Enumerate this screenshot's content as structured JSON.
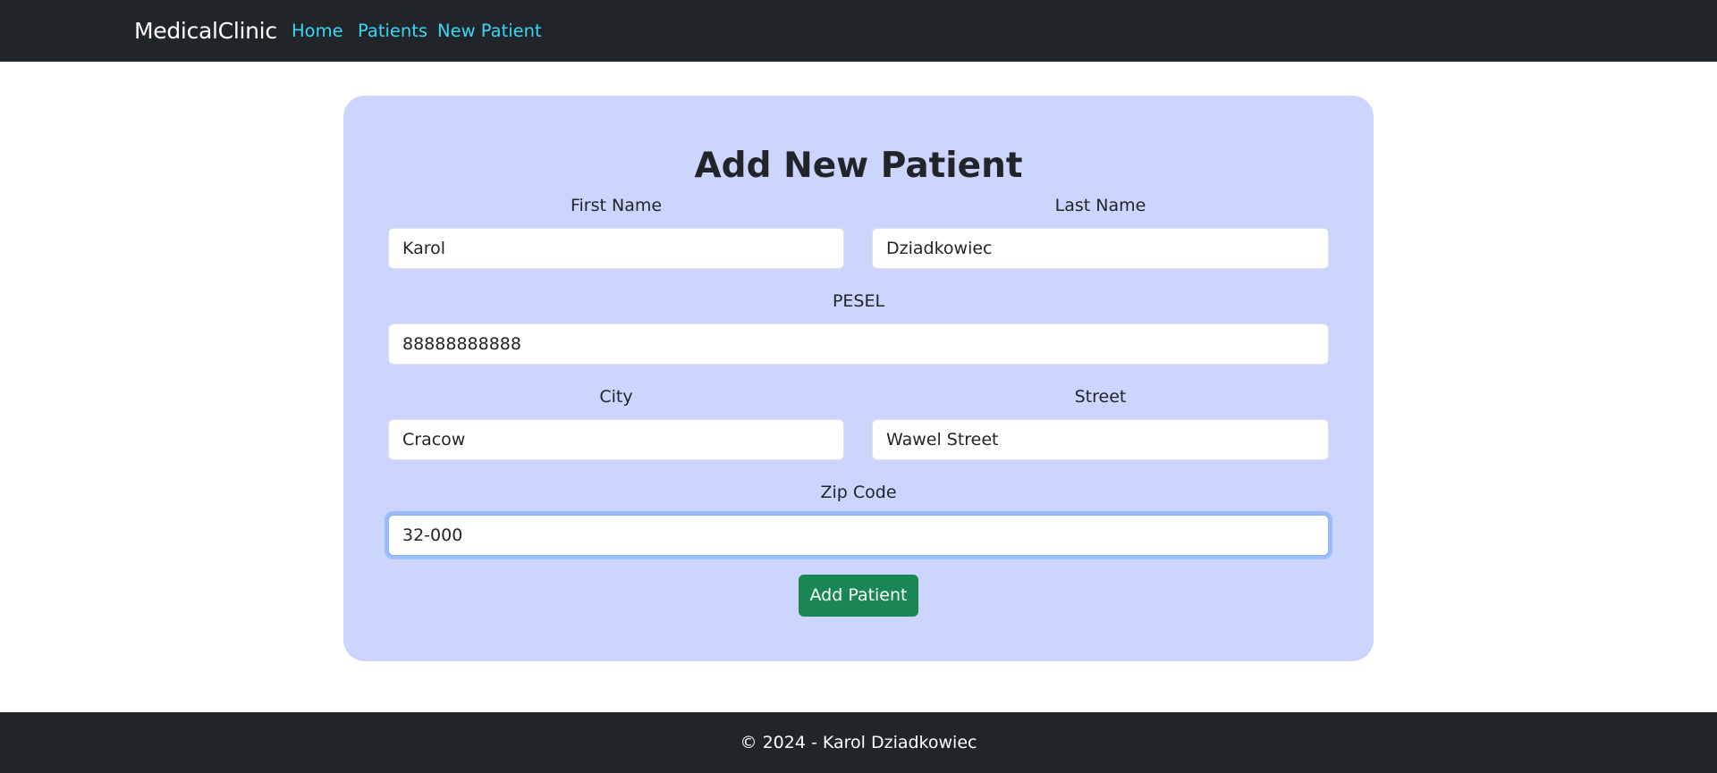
{
  "navbar": {
    "brand": "MedicalClinic",
    "links": [
      {
        "label": "Home"
      },
      {
        "label": "Patients"
      },
      {
        "label": "New Patient"
      }
    ]
  },
  "form": {
    "title": "Add New Patient",
    "fields": {
      "first_name": {
        "label": "First Name",
        "value": "Karol"
      },
      "last_name": {
        "label": "Last Name",
        "value": "Dziadkowiec"
      },
      "pesel": {
        "label": "PESEL",
        "value": "88888888888"
      },
      "city": {
        "label": "City",
        "value": "Cracow"
      },
      "street": {
        "label": "Street",
        "value": "Wawel Street"
      },
      "zip_code": {
        "label": "Zip Code",
        "value": "32-000",
        "focused": true
      }
    },
    "submit_label": "Add Patient"
  },
  "footer": {
    "text": "© 2024 - Karol Dziadkowiec"
  },
  "colors": {
    "navbar_bg": "#212529",
    "nav_link": "#3dd5f3",
    "card_bg": "#ccd5fd",
    "submit_bg": "#198754",
    "focus_ring": "#86b7fe"
  }
}
